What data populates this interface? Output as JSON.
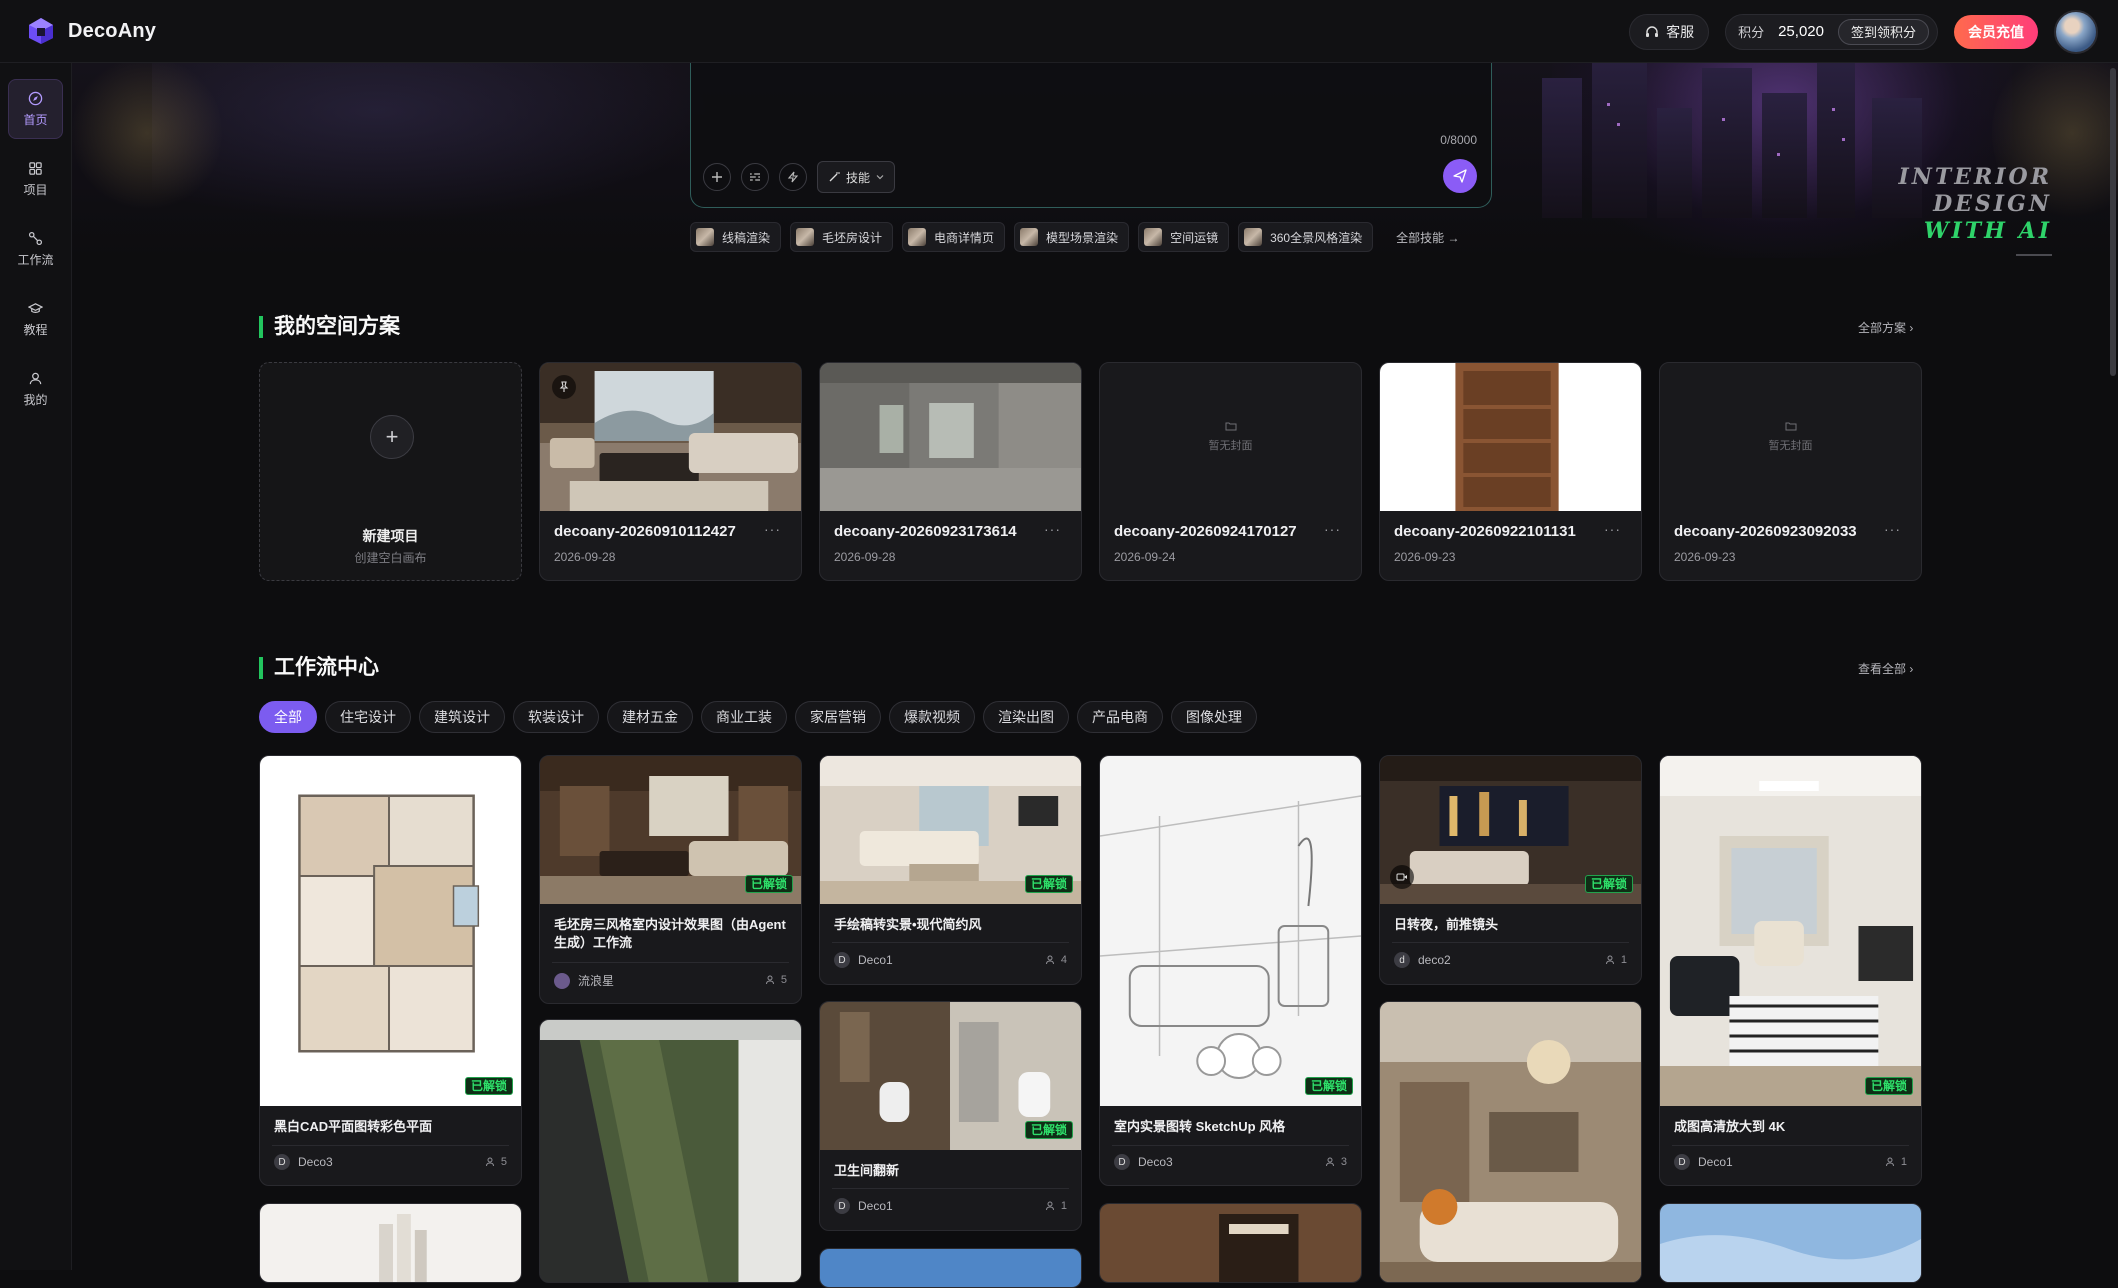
{
  "app": {
    "name": "DecoAny"
  },
  "header": {
    "service_label": "客服",
    "points_label": "积分",
    "points_value": "25,020",
    "signin_label": "签到领积分",
    "vip_label": "会员充值"
  },
  "sidebar": {
    "items": [
      {
        "label": "首页",
        "icon": "compass-icon",
        "active": true
      },
      {
        "label": "项目",
        "icon": "grid-icon"
      },
      {
        "label": "工作流",
        "icon": "flow-icon"
      },
      {
        "label": "教程",
        "icon": "graduation-icon"
      },
      {
        "label": "我的",
        "icon": "user-icon"
      }
    ]
  },
  "prompt": {
    "counter": "0/8000",
    "skill_button": "技能"
  },
  "skills": {
    "items": [
      "线稿渲染",
      "毛坯房设计",
      "电商详情页",
      "模型场景渲染",
      "空间运镜",
      "360全景风格渲染"
    ],
    "all_label": "全部技能"
  },
  "tagline": {
    "line1": "INTERIOR",
    "line2": "DESIGN",
    "line3": "WITH AI"
  },
  "projects": {
    "title": "我的空间方案",
    "all_label": "全部方案",
    "new": {
      "title": "新建项目",
      "subtitle": "创建空白画布"
    },
    "no_cover": "暂无封面",
    "items": [
      {
        "name": "decoany-20260910112427",
        "date": "2026-09-28",
        "cover": "living-room"
      },
      {
        "name": "decoany-20260923173614",
        "date": "2026-09-28",
        "cover": "concrete-room"
      },
      {
        "name": "decoany-20260924170127",
        "date": "2026-09-24",
        "cover": "none"
      },
      {
        "name": "decoany-20260922101131",
        "date": "2026-09-23",
        "cover": "bookshelf"
      },
      {
        "name": "decoany-20260923092033",
        "date": "2026-09-23",
        "cover": "none"
      }
    ]
  },
  "workflows": {
    "title": "工作流中心",
    "all_label": "查看全部",
    "unlocked_label": "已解锁",
    "filters": [
      "全部",
      "住宅设计",
      "建筑设计",
      "软装设计",
      "建材五金",
      "商业工装",
      "家居营销",
      "爆款视频",
      "渲染出图",
      "产品电商",
      "图像处理"
    ],
    "cards": [
      {
        "title": "黑白CAD平面图转彩色平面",
        "author": "Deco3",
        "avatar": "D",
        "count": "5"
      },
      {
        "title": "毛坯房三风格室内设计效果图（由Agent 生成）工作流",
        "author": "流浪星",
        "avatar": "",
        "count": "5"
      },
      {
        "title": "手绘稿转实景•现代简约风",
        "author": "Deco1",
        "avatar": "D",
        "count": "4"
      },
      {
        "title": "卫生间翻新",
        "author": "Deco1",
        "avatar": "D",
        "count": "1"
      },
      {
        "title": "室内实景图转 SketchUp 风格",
        "author": "Deco3",
        "avatar": "D",
        "count": "3"
      },
      {
        "title": "日转夜，前推镜头",
        "author": "deco2",
        "avatar": "d",
        "count": "1"
      },
      {
        "title": "成图高清放大到 4K",
        "author": "Deco1",
        "avatar": "D",
        "count": "1"
      }
    ]
  }
}
